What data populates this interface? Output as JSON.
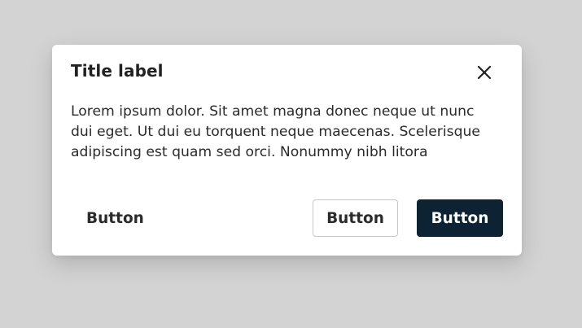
{
  "dialog": {
    "title": "Title label",
    "body": "Lorem ipsum dolor. Sit amet magna donec neque ut nunc dui eget. Ut dui eu torquent neque maecenas. Scelerisque adipiscing est quam sed orci. Nonummy nibh litora",
    "close_icon": "close-icon",
    "buttons": {
      "text": "Button",
      "outline": "Button",
      "primary": "Button"
    }
  },
  "colors": {
    "backdrop": "#d3d3d3",
    "surface": "#ffffff",
    "primary": "#0d2233",
    "text": "#2b2b2b"
  }
}
